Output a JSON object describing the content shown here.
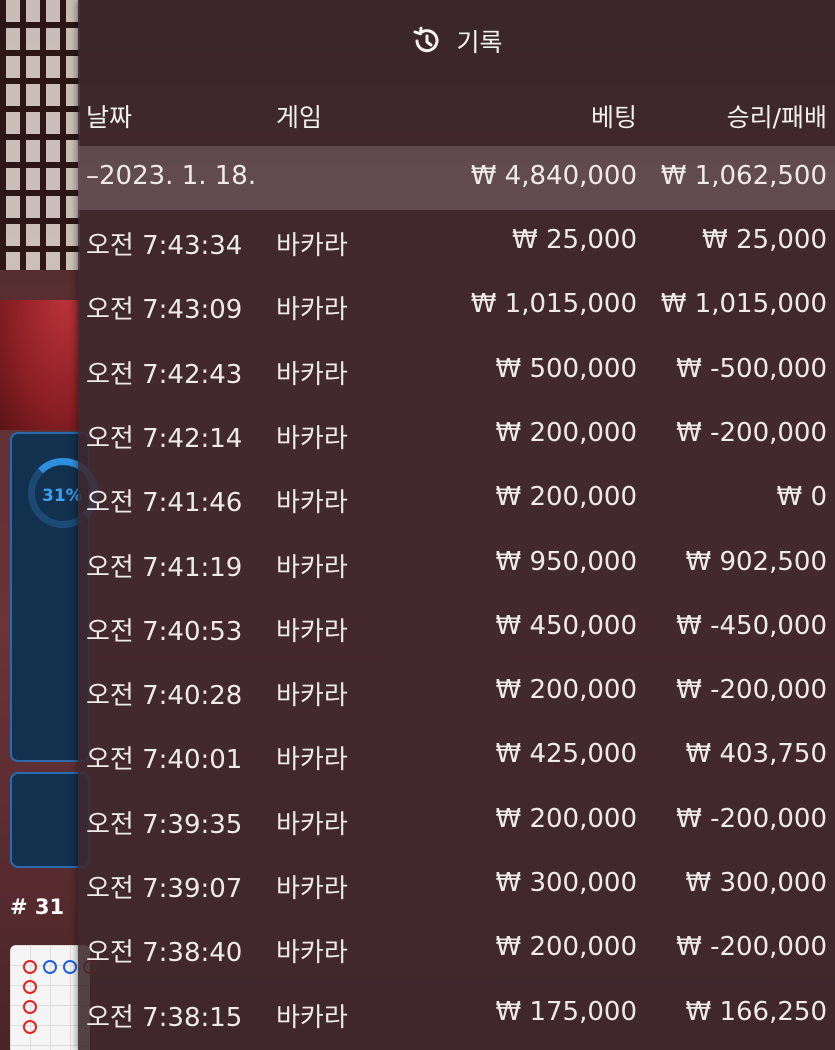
{
  "background": {
    "progress_percent": "31%",
    "round_number": "# 31"
  },
  "header": {
    "title": "기록",
    "icon": "history-icon"
  },
  "columns": {
    "date": "날짜",
    "game": "게임",
    "bet": "베팅",
    "result": "승리/패배"
  },
  "summary": {
    "date": "–2023. 1. 18.",
    "bet": "₩ 4,840,000",
    "result": "₩ 1,062,500"
  },
  "rows": [
    {
      "time": "오전 7:43:34",
      "game": "바카라",
      "bet": "₩ 25,000",
      "result": "₩ 25,000"
    },
    {
      "time": "오전 7:43:09",
      "game": "바카라",
      "bet": "₩ 1,015,000",
      "result": "₩ 1,015,000"
    },
    {
      "time": "오전 7:42:43",
      "game": "바카라",
      "bet": "₩ 500,000",
      "result": "₩ -500,000"
    },
    {
      "time": "오전 7:42:14",
      "game": "바카라",
      "bet": "₩ 200,000",
      "result": "₩ -200,000"
    },
    {
      "time": "오전 7:41:46",
      "game": "바카라",
      "bet": "₩ 200,000",
      "result": "₩ 0"
    },
    {
      "time": "오전 7:41:19",
      "game": "바카라",
      "bet": "₩ 950,000",
      "result": "₩ 902,500"
    },
    {
      "time": "오전 7:40:53",
      "game": "바카라",
      "bet": "₩ 450,000",
      "result": "₩ -450,000"
    },
    {
      "time": "오전 7:40:28",
      "game": "바카라",
      "bet": "₩ 200,000",
      "result": "₩ -200,000"
    },
    {
      "time": "오전 7:40:01",
      "game": "바카라",
      "bet": "₩ 425,000",
      "result": "₩ 403,750"
    },
    {
      "time": "오전 7:39:35",
      "game": "바카라",
      "bet": "₩ 200,000",
      "result": "₩ -200,000"
    },
    {
      "time": "오전 7:39:07",
      "game": "바카라",
      "bet": "₩ 300,000",
      "result": "₩ 300,000"
    },
    {
      "time": "오전 7:38:40",
      "game": "바카라",
      "bet": "₩ 200,000",
      "result": "₩ -200,000"
    },
    {
      "time": "오전 7:38:15",
      "game": "바카라",
      "bet": "₩ 175,000",
      "result": "₩ 166,250"
    }
  ]
}
